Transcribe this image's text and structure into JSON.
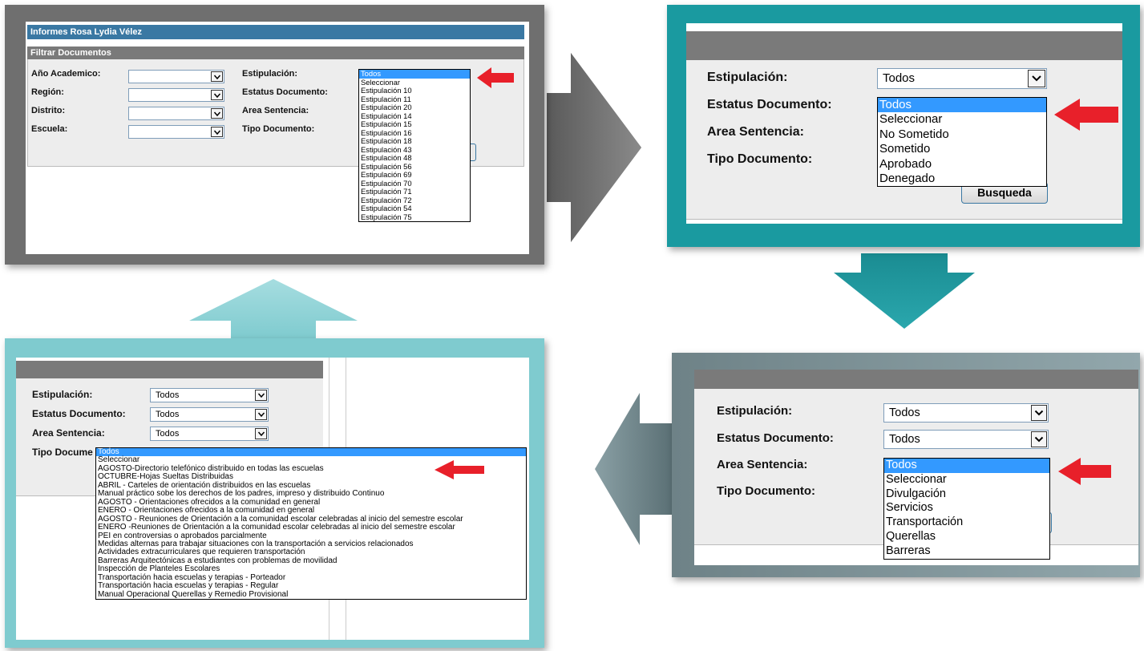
{
  "colors": {
    "frame_gray": "#6f6f6f",
    "frame_teal": "#1a9aa0",
    "frame_light_teal": "#7fcbcf",
    "header_blue": "#3a78a3",
    "header_gray": "#7a7a7a",
    "highlight": "#3399ff",
    "red_arrow": "#e8202a"
  },
  "panel1": {
    "title": "Informes Rosa Lydia Vélez",
    "section": "Filtrar Documentos",
    "left_labels": [
      "Año Academico:",
      "Región:",
      "Distrito:",
      "Escuela:"
    ],
    "right_labels": [
      "Estipulación:",
      "Estatus Documento:",
      "Area Sentencia:",
      "Tipo Documento:"
    ],
    "dropdown": [
      "Todos",
      "Seleccionar",
      "Estipulación 10",
      "Estipulación 11",
      "Estipulación 20",
      "Estipulación 14",
      "Estipulación 15",
      "Estipulación 16",
      "Estipulación 18",
      "Estipulación 43",
      "Estipulación 48",
      "Estipulación 56",
      "Estipulación 69",
      "Estipulación 70",
      "Estipulación 71",
      "Estipulación 72",
      "Estipulación 54",
      "Estipulación 75"
    ]
  },
  "panel2": {
    "labels": [
      "Estipulación:",
      "Estatus Documento:",
      "Area Sentencia:",
      "Tipo Documento:"
    ],
    "estipulacion_value": "Todos",
    "dropdown": [
      "Todos",
      "Seleccionar",
      "No Sometido",
      "Sometido",
      "Aprobado",
      "Denegado"
    ],
    "button": "Busqueda"
  },
  "panel3": {
    "labels": [
      "Estipulación:",
      "Estatus Documento:",
      "Area Sentencia:",
      "Tipo Documento:"
    ],
    "values": [
      "Todos",
      "Todos"
    ],
    "dropdown": [
      "Todos",
      "Seleccionar",
      "Divulgación",
      "Servicios",
      "Transportación",
      "Querellas",
      "Barreras"
    ]
  },
  "panel4": {
    "labels": [
      "Estipulación:",
      "Estatus Documento:",
      "Area Sentencia:",
      "Tipo Docume"
    ],
    "values": [
      "Todos",
      "Todos",
      "Todos"
    ],
    "dropdown": [
      "Todos",
      "Seleccionar",
      "AGOSTO-Directorio telefónico distribuido en todas las escuelas",
      "OCTUBRE-Hojas Sueltas Distribuidas",
      "ABRIL - Carteles de orientación distribuidos en las escuelas",
      "Manual práctico sobe los derechos de los padres, impreso y distribuido Continuo",
      "AGOSTO - Orientaciones ofrecidos a la comunidad en general",
      "ENERO - Orientaciones ofrecidos a la comunidad en general",
      "AGOSTO - Reuniones de Orientación a la comunidad escolar celebradas al inicio del semestre escolar",
      "ENERO -Reuniones de Orientación a la comunidad escolar celebradas al inicio del semestre escolar",
      "PEI en controversias o aprobados parcialmente",
      "Medidas alternas para trabajar situaciones con la transportación a servicios relacionados",
      "Actividades extracurriculares que requieren transportación",
      "Barreras Arquitectónicas a estudiantes con problemas de movilidad",
      "Inspección de Planteles Escolares",
      "Transportación hacia escuelas y terapias - Porteador",
      "Transportación hacia escuelas y terapias - Regular",
      "Manual Operacional Querellas y Remedio Provisional"
    ]
  }
}
